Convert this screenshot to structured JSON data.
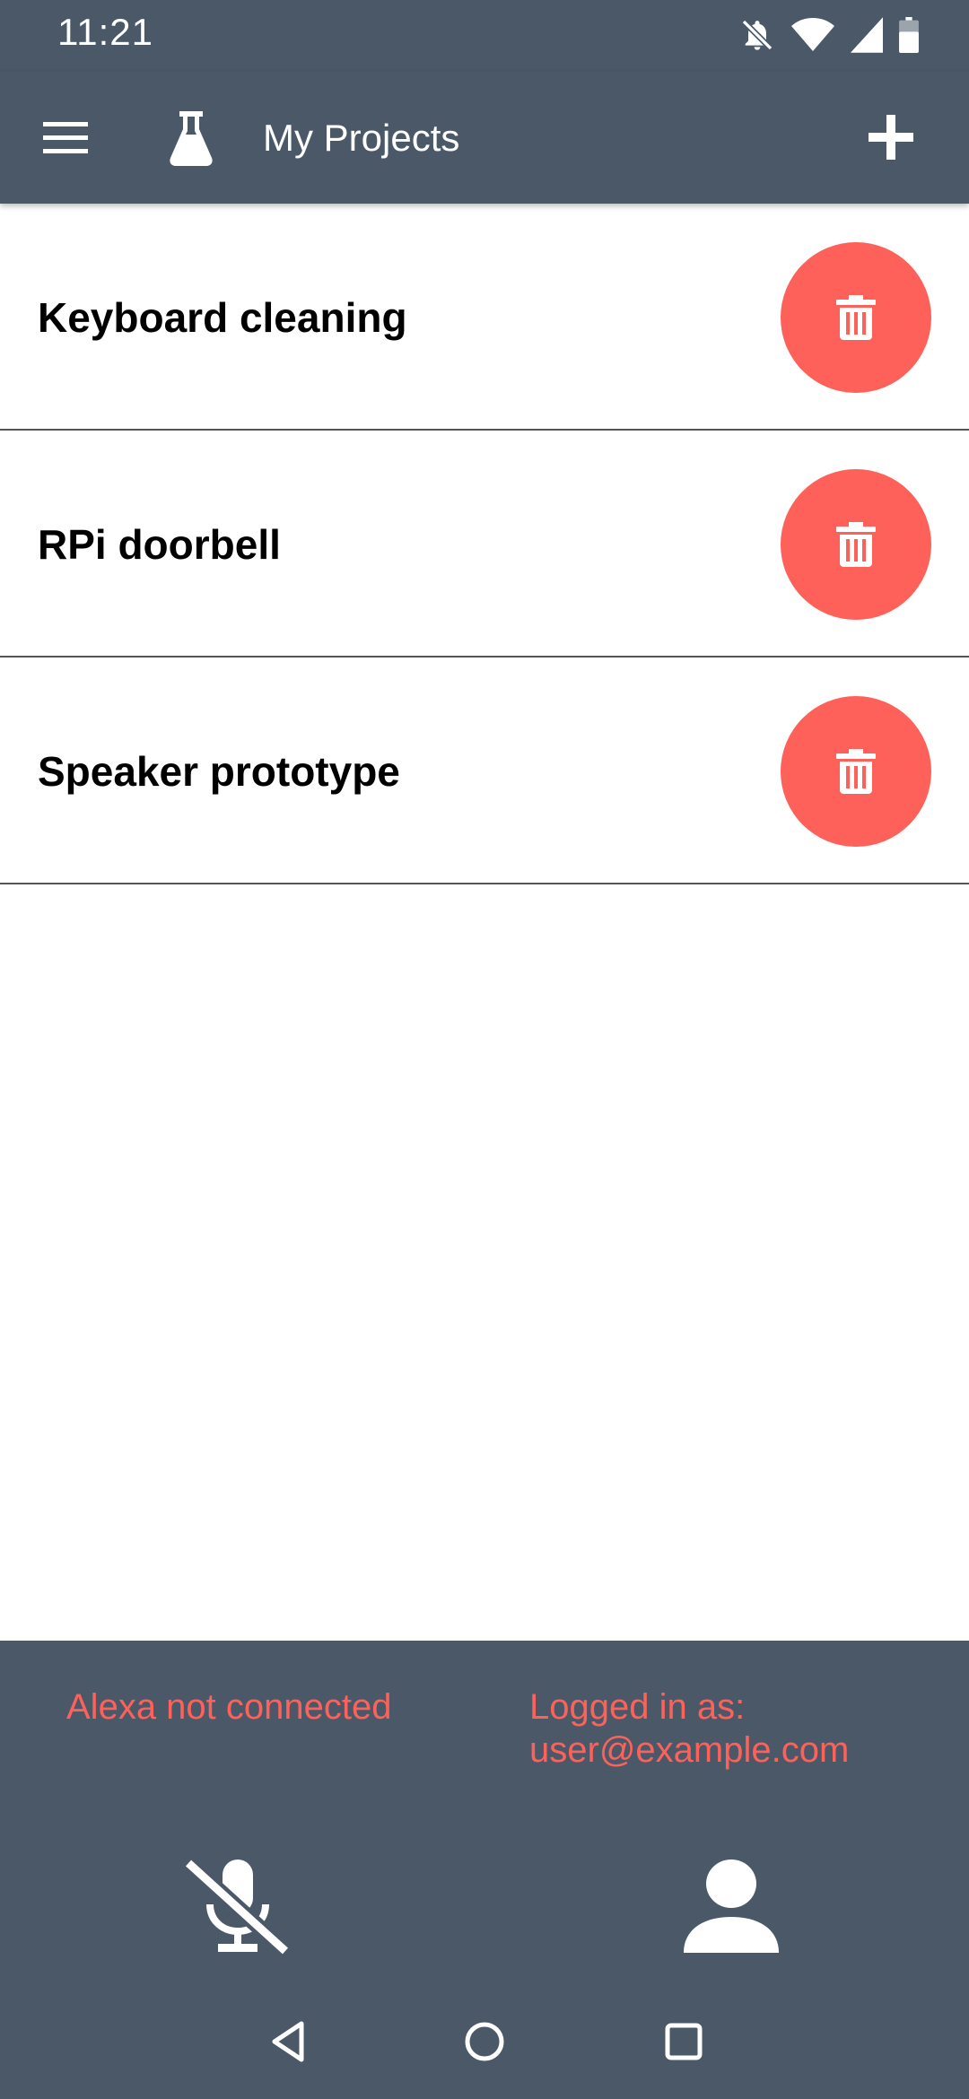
{
  "status_bar": {
    "time": "11:21",
    "icons": [
      "notifications-off-icon",
      "wifi-icon",
      "cellular-signal-icon",
      "battery-icon"
    ]
  },
  "app_bar": {
    "title": "My Projects",
    "menu_icon": "hamburger-menu-icon",
    "logo_icon": "flask-icon",
    "add_icon": "plus-icon"
  },
  "projects": [
    {
      "name": "Keyboard cleaning",
      "action_icon": "trash-icon"
    },
    {
      "name": "RPi doorbell",
      "action_icon": "trash-icon"
    },
    {
      "name": "Speaker prototype",
      "action_icon": "trash-icon"
    }
  ],
  "footer": {
    "alexa_status": "Alexa not connected",
    "login_label": "Logged in as:",
    "login_email": "user@example.com",
    "mic_icon": "microphone-off-icon",
    "account_icon": "person-icon"
  },
  "nav": {
    "back_icon": "back-triangle-icon",
    "home_icon": "home-circle-icon",
    "recent_icon": "recent-square-icon"
  },
  "colors": {
    "bar_background": "#4a5868",
    "accent_red": "#fe6159",
    "list_divider": "#555555",
    "text_primary": "#000000"
  }
}
